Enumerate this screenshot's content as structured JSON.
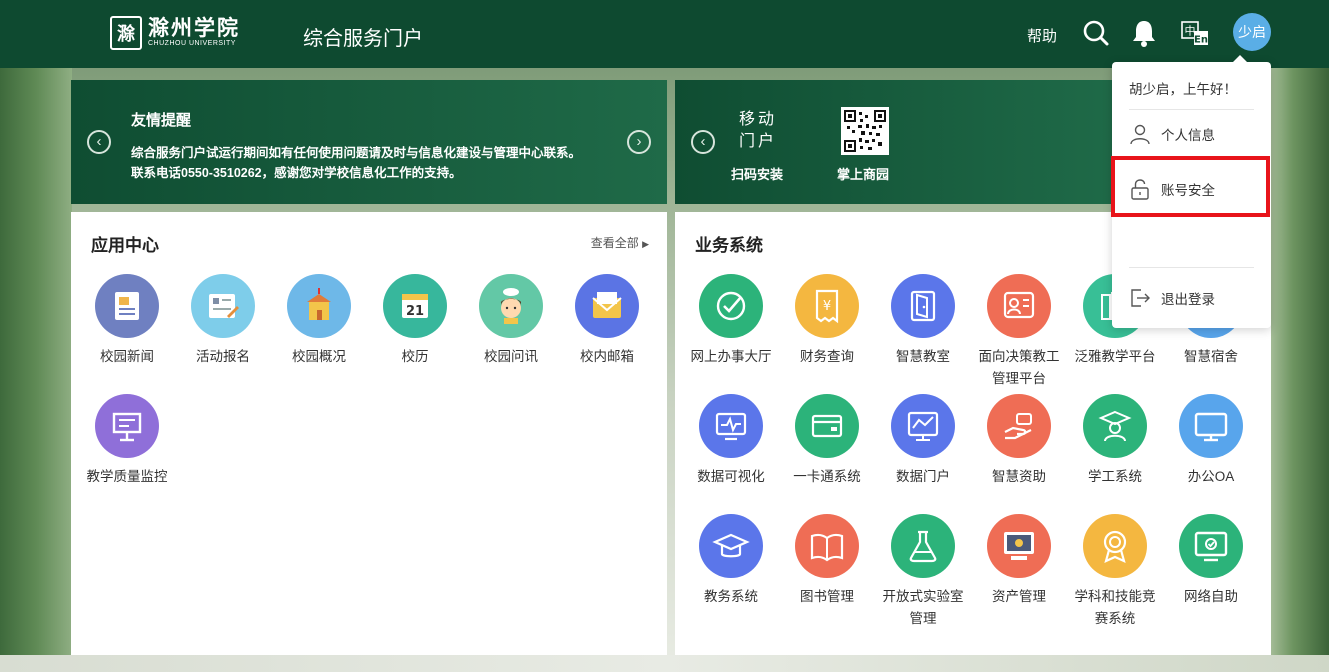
{
  "header": {
    "logo_mark": "滁",
    "logo_cn": "滁州学院",
    "logo_en": "CHUZHOU UNIVERSITY",
    "portal_title": "综合服务门户",
    "help": "帮助",
    "avatar_text": "少启",
    "icons": [
      "search-icon",
      "bell-icon",
      "language-switch-icon"
    ]
  },
  "notice_banner": {
    "title": "友情提醒",
    "line1": "综合服务门户试运行期间如有任何使用问题请及时与信息化建设与管理中心联系。",
    "line2": "联系电话0550-3510262，感谢您对学校信息化工作的支持。"
  },
  "mobile_banner": {
    "label": "移动门户",
    "scan_install": "扫码安装",
    "app_name": "掌上商园"
  },
  "app_center": {
    "title": "应用中心",
    "view_all": "查看全部",
    "apps": [
      {
        "label": "校园新闻",
        "icon": "newspaper-icon",
        "color": "#6f80c1"
      },
      {
        "label": "活动报名",
        "icon": "form-icon",
        "color": "#7ecdea"
      },
      {
        "label": "校园概况",
        "icon": "building-icon",
        "color": "#6eb8e8"
      },
      {
        "label": "校历",
        "icon": "calendar-icon",
        "color": "#37b79c"
      },
      {
        "label": "校园问讯",
        "icon": "student-icon",
        "color": "#63c8a6"
      },
      {
        "label": "校内邮箱",
        "icon": "envelope-icon",
        "color": "#5b74e4"
      },
      {
        "label": "教学质量监控",
        "icon": "presentation-icon",
        "color": "#8f6fd9"
      }
    ]
  },
  "business": {
    "title": "业务系统",
    "apps": [
      {
        "label": "网上办事大厅",
        "icon": "check-icon",
        "color": "#2cb37a"
      },
      {
        "label": "财务查询",
        "icon": "receipt-icon",
        "color": "#f4b740"
      },
      {
        "label": "智慧教室",
        "icon": "door-icon",
        "color": "#5b76ea"
      },
      {
        "label": "面向决策教工管理平台",
        "icon": "teacher-icon",
        "color": "#ef6d55"
      },
      {
        "label": "泛雅教学平台",
        "icon": "books-icon",
        "color": "#38bf96"
      },
      {
        "label": "智慧宿舍",
        "icon": "dorm-icon",
        "color": "#58a5ec"
      },
      {
        "label": "数据可视化",
        "icon": "monitor-pulse-icon",
        "color": "#5b76ea"
      },
      {
        "label": "一卡通系统",
        "icon": "card-icon",
        "color": "#2cb37a"
      },
      {
        "label": "数据门户",
        "icon": "chart-screen-icon",
        "color": "#5b76ea"
      },
      {
        "label": "智慧资助",
        "icon": "hand-icon",
        "color": "#ef6d55"
      },
      {
        "label": "学工系统",
        "icon": "graduate-icon",
        "color": "#2cb37a"
      },
      {
        "label": "办公OA",
        "icon": "desktop-icon",
        "color": "#58a5ec"
      },
      {
        "label": "教务系统",
        "icon": "mortarboard-icon",
        "color": "#5b76ea"
      },
      {
        "label": "图书管理",
        "icon": "open-book-icon",
        "color": "#ef6d55"
      },
      {
        "label": "开放式实验室管理",
        "icon": "flask-icon",
        "color": "#2cb37a"
      },
      {
        "label": "资产管理",
        "icon": "computer-asset-icon",
        "color": "#ef6d55"
      },
      {
        "label": "学科和技能竞赛系统",
        "icon": "medal-icon",
        "color": "#f4b740"
      },
      {
        "label": "网络自助",
        "icon": "network-screen-icon",
        "color": "#2cb37a"
      }
    ]
  },
  "user_menu": {
    "greeting": "胡少启，上午好！",
    "profile": "个人信息",
    "security": "账号安全",
    "logout": "退出登录"
  }
}
